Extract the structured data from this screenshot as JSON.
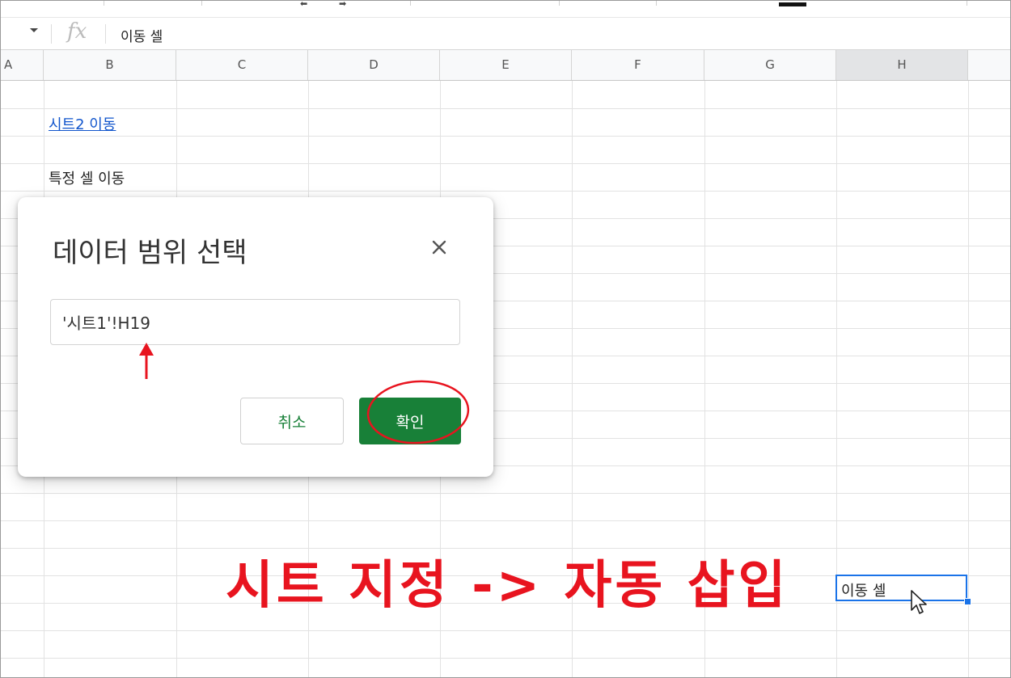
{
  "formula_bar": {
    "formula_text": "이동 셀"
  },
  "columns": [
    "A",
    "B",
    "C",
    "D",
    "E",
    "F",
    "G",
    "H"
  ],
  "active_column": "H",
  "cells": {
    "b3": "시트2 이동",
    "b5": "특정 셀 이동",
    "h19": "이동 셀"
  },
  "dialog": {
    "title": "데이터 범위 선택",
    "range_value": "'시트1'!H19",
    "cancel_label": "취소",
    "ok_label": "확인"
  },
  "annotation": {
    "text": "시트 지정 -> 자동 삽입",
    "color": "#e8141f"
  },
  "colors": {
    "accent_green": "#188038",
    "selection_blue": "#1a73e8",
    "link_blue": "#1155cc"
  }
}
